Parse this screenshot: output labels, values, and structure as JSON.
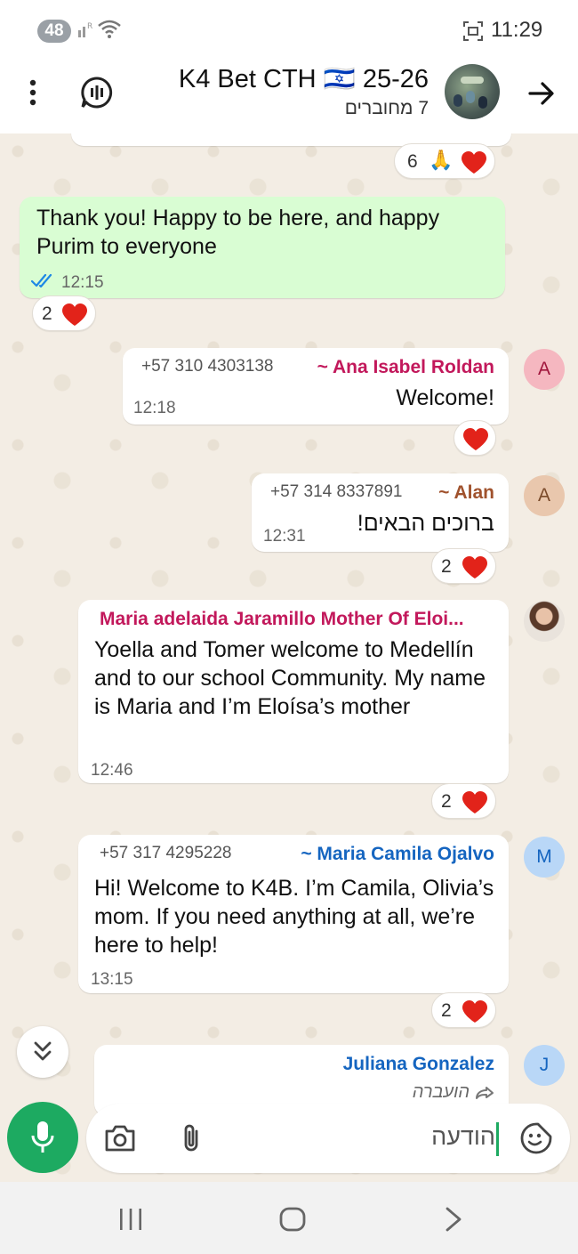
{
  "status_bar": {
    "badge": "48",
    "time": "11:29"
  },
  "header": {
    "title": "K4 Bet CTH 🇮🇱 25-26",
    "subtitle": "7 מחוברים"
  },
  "messages": {
    "top_reaction_count": "6",
    "m1": {
      "text": "Thank you! Happy to be here, and happy Purim to everyone",
      "time": "12:15",
      "reaction_count": "2"
    },
    "m2": {
      "phone": "+57 310 4303138",
      "sender": "~ Ana Isabel Roldan",
      "text": "Welcome!",
      "time": "12:18",
      "avatar_letter": "A"
    },
    "m3": {
      "phone": "+57 314 8337891",
      "sender": "~ Alan",
      "text": "ברוכים הבאים!",
      "time": "12:31",
      "avatar_letter": "A",
      "reaction_count": "2"
    },
    "m4": {
      "sender": "Maria adelaida Jaramillo Mother Of Eloi...",
      "text": "Yoella and Tomer welcome to Medellín and to our school Community. My name is Maria and I’m Eloísa’s mother",
      "time": "12:46",
      "reaction_count": "2"
    },
    "m5": {
      "phone": "+57 317 4295228",
      "sender": "~ Maria Camila Ojalvo",
      "text": "Hi! Welcome to K4B. I’m Camila, Olivia’s mom. If you need anything at all, we’re here to help!",
      "time": "13:15",
      "avatar_letter": "M",
      "reaction_count": "2"
    },
    "m6": {
      "sender": "Juliana Gonzalez",
      "forwarded_label": "הועברה",
      "avatar_letter": "J"
    }
  },
  "composer": {
    "placeholder": "הודעה"
  },
  "colors": {
    "accent_green": "#1daa61",
    "outgoing_bubble": "#d9fdd3",
    "sender_ana": "#c2185b",
    "sender_alan": "#a0522d",
    "sender_maria_a": "#c2185b",
    "sender_camila": "#1565c0",
    "sender_juliana": "#1565c0",
    "read_ticks": "#1e88e5"
  }
}
